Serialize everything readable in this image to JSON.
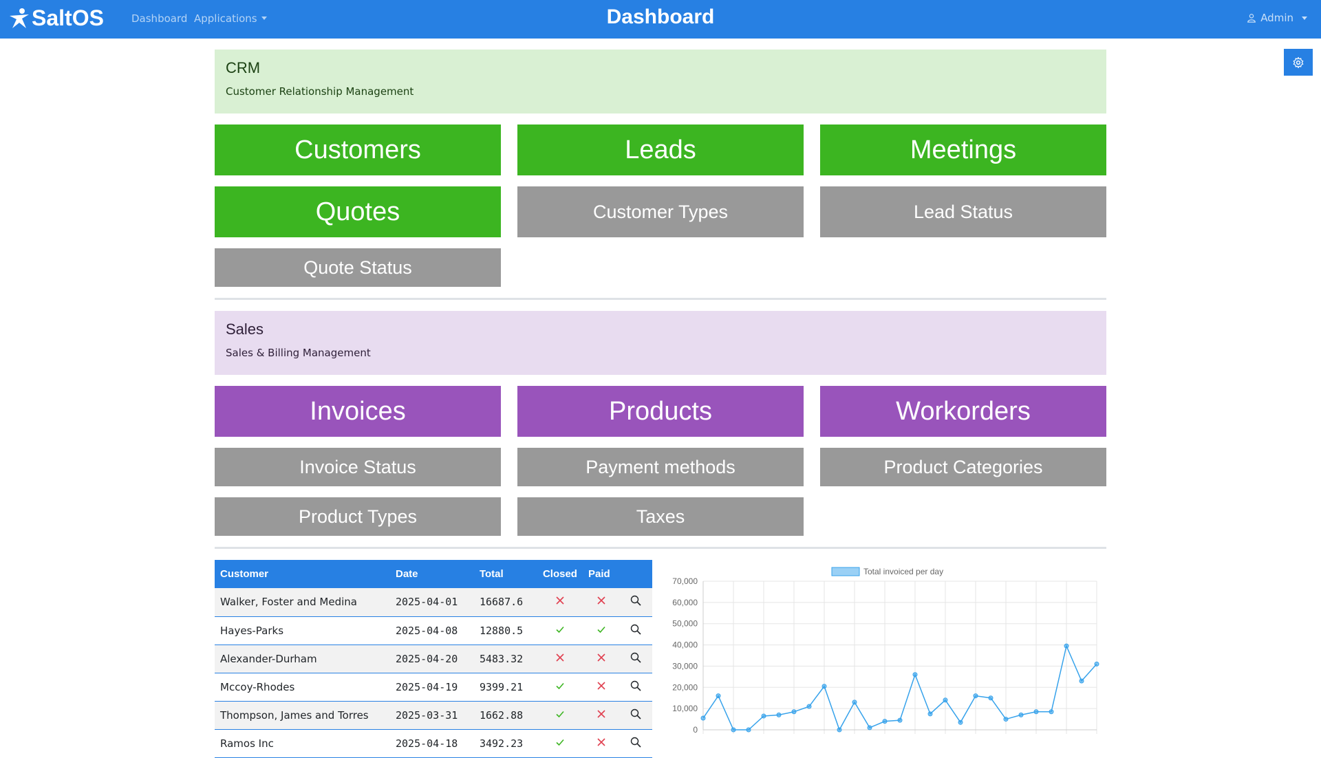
{
  "navbar": {
    "brand": "SaltOS",
    "links": [
      "Dashboard",
      "Applications"
    ],
    "title": "Dashboard",
    "user": "Admin",
    "colors": {
      "primary": "#2780e3"
    }
  },
  "crm": {
    "title": "CRM",
    "subtitle": "Customer Relationship Management",
    "tiles_primary": [
      "Customers",
      "Leads",
      "Meetings",
      "Quotes"
    ],
    "tiles_secondary": [
      "Customer Types",
      "Lead Status",
      "Quote Status"
    ],
    "color": "#3cb521"
  },
  "sales": {
    "title": "Sales",
    "subtitle": "Sales & Billing Management",
    "tiles_primary": [
      "Invoices",
      "Products",
      "Workorders"
    ],
    "tiles_secondary": [
      "Invoice Status",
      "Payment methods",
      "Product Categories",
      "Product Types",
      "Taxes"
    ],
    "color": "#9954bb"
  },
  "table": {
    "headers": [
      "Customer",
      "Date",
      "Total",
      "Closed",
      "Paid"
    ],
    "rows": [
      {
        "customer": "Walker, Foster and Medina",
        "date": "2025-04-01",
        "total": "16687.6",
        "closed": false,
        "paid": false
      },
      {
        "customer": "Hayes-Parks",
        "date": "2025-04-08",
        "total": "12880.5",
        "closed": true,
        "paid": true
      },
      {
        "customer": "Alexander-Durham",
        "date": "2025-04-20",
        "total": "5483.32",
        "closed": false,
        "paid": false
      },
      {
        "customer": "Mccoy-Rhodes",
        "date": "2025-04-19",
        "total": "9399.21",
        "closed": true,
        "paid": false
      },
      {
        "customer": "Thompson, James and Torres",
        "date": "2025-03-31",
        "total": "1662.88",
        "closed": true,
        "paid": false
      },
      {
        "customer": "Ramos Inc",
        "date": "2025-04-18",
        "total": "3492.23",
        "closed": true,
        "paid": false
      }
    ]
  },
  "chart_data": {
    "type": "line",
    "series": [
      {
        "name": "Total invoiced per day",
        "values": [
          5500,
          16000,
          0,
          0,
          6500,
          7000,
          8500,
          11000,
          20500,
          0,
          13000,
          1000,
          4000,
          4500,
          26000,
          7500,
          14000,
          3500,
          16000,
          15000,
          5000,
          7000,
          8500,
          8500,
          39500,
          23000,
          31000
        ]
      }
    ],
    "ylim": [
      0,
      70000
    ],
    "yticks": [
      "70,000",
      "60,000",
      "50,000",
      "40,000",
      "30,000",
      "20,000",
      "10,000",
      "0"
    ],
    "grid": true,
    "legend": "top",
    "color": "#36a2eb"
  }
}
